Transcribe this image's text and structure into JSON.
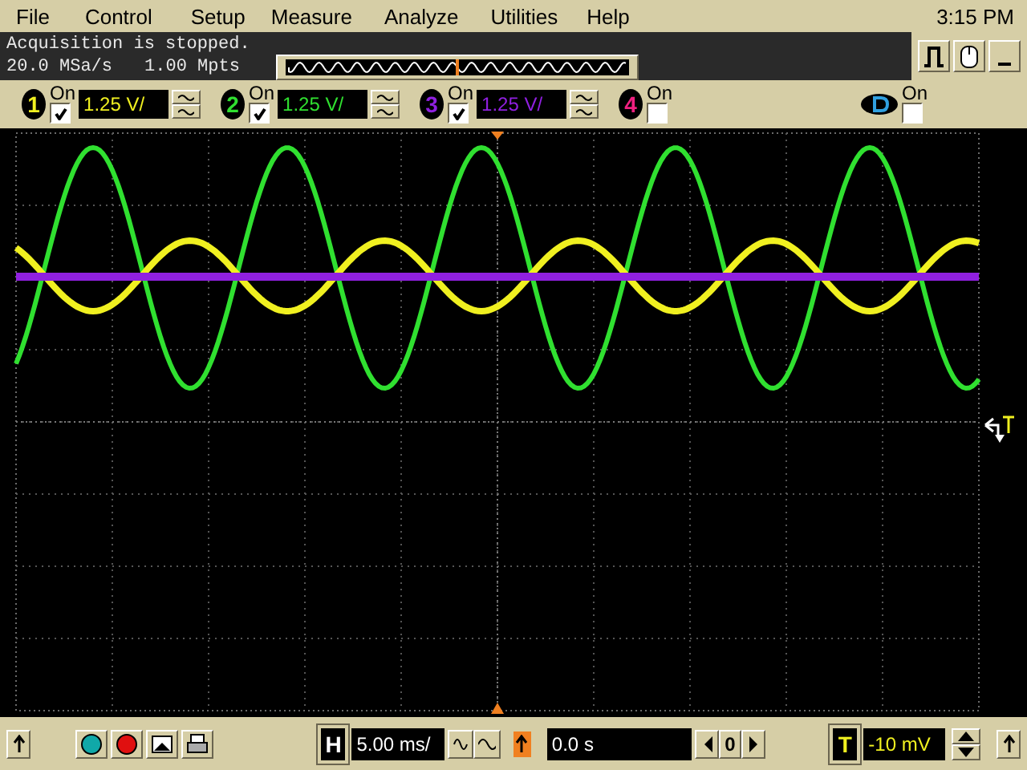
{
  "menu": [
    "File",
    "Control",
    "Setup",
    "Measure",
    "Analyze",
    "Utilities",
    "Help"
  ],
  "clock": "3:15 PM",
  "status": {
    "message": "Acquisition is stopped.",
    "sample_rate": "20.0 MSa/s",
    "memory": "1.00 Mpts"
  },
  "channels": [
    {
      "number": "1",
      "on_label": "On",
      "on": true,
      "scale": "1.25 V/",
      "color": "#f0f020"
    },
    {
      "number": "2",
      "on_label": "On",
      "on": true,
      "scale": "1.25 V/",
      "color": "#30e030"
    },
    {
      "number": "3",
      "on_label": "On",
      "on": true,
      "scale": "1.25 V/",
      "color": "#9020e0"
    },
    {
      "number": "4",
      "on_label": "On",
      "on": false,
      "color": "#f02080"
    }
  ],
  "digital": {
    "on_label": "On",
    "on": false
  },
  "horizontal": {
    "label": "H",
    "timebase": "5.00 ms/",
    "delay": "0.0 s",
    "ref": "0"
  },
  "trigger": {
    "label": "T",
    "level": "-10 mV"
  }
}
